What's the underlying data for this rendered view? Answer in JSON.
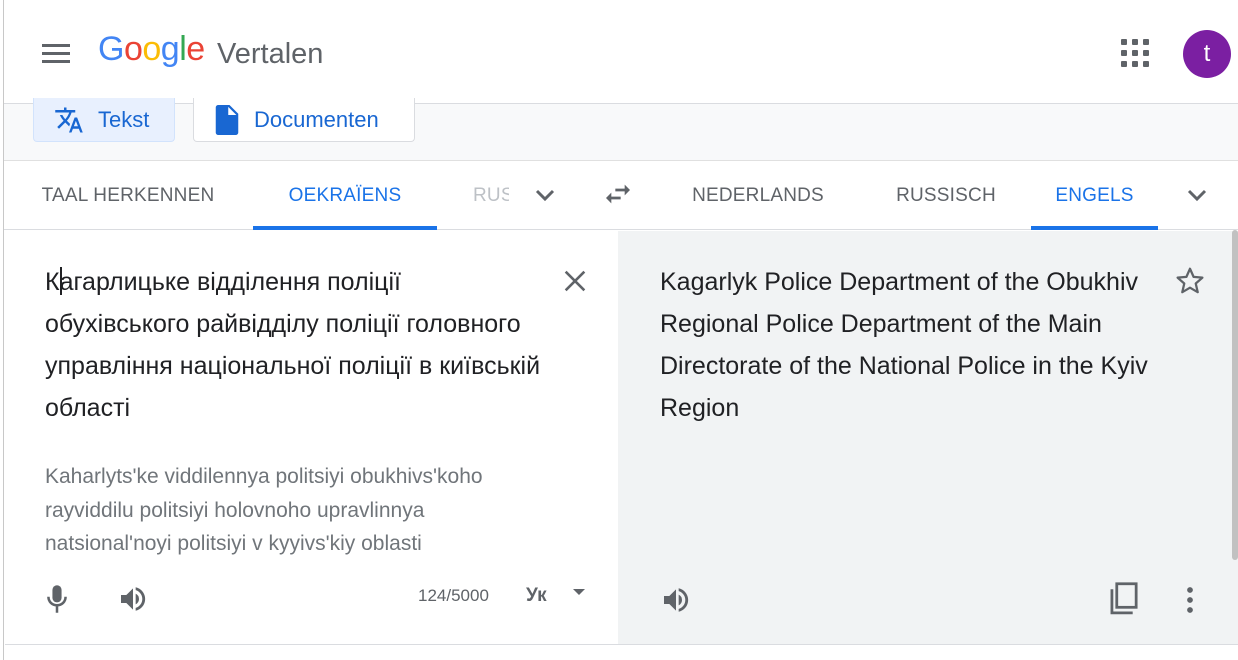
{
  "header": {
    "logo": {
      "g1": "G",
      "o1": "o",
      "o2": "o",
      "g2": "g",
      "l": "l",
      "e": "e"
    },
    "product": "Vertalen",
    "avatar_letter": "t"
  },
  "modes": {
    "text_label": "Tekst",
    "docs_label": "Documenten"
  },
  "source_langs": [
    "TAAL HERKENNEN",
    "OEKRAÏENS",
    "RUS"
  ],
  "target_langs": [
    "NEDERLANDS",
    "RUSSISCH",
    "ENGELS"
  ],
  "source": {
    "text": "Кагарлицьке відділення поліції обухівського райвідділу поліції головного управління національної поліції в київській області",
    "text_first": "К",
    "text_rest": "агарлицьке відділення поліції обухівського райвідділу поліції головного управління національної поліції в київській області",
    "transliteration": "Kaharlyts'ke viddilennya politsiyi obukhivs'koho rayviddilu politsiyi holovnoho upravlinnya natsional'noyi politsiyi v kyyivs'kiy oblasti",
    "char_count": "124/5000",
    "keyboard_label": "Ук"
  },
  "target": {
    "text": "Kagarlyk Police Department of the Obukhiv Regional Police Department of the Main Directorate of the National Police in the Kyiv Region"
  },
  "colors": {
    "accent": "#1a73e8",
    "avatar": "#7b1fa2",
    "target_bg": "#f1f3f4"
  },
  "icons": [
    "menu-icon",
    "apps-grid-icon",
    "translate-icon",
    "document-icon",
    "chevron-down-icon",
    "swap-icon",
    "close-icon",
    "mic-icon",
    "speaker-icon",
    "keyboard-dropdown-icon",
    "star-icon",
    "copy-icon",
    "more-vert-icon"
  ]
}
